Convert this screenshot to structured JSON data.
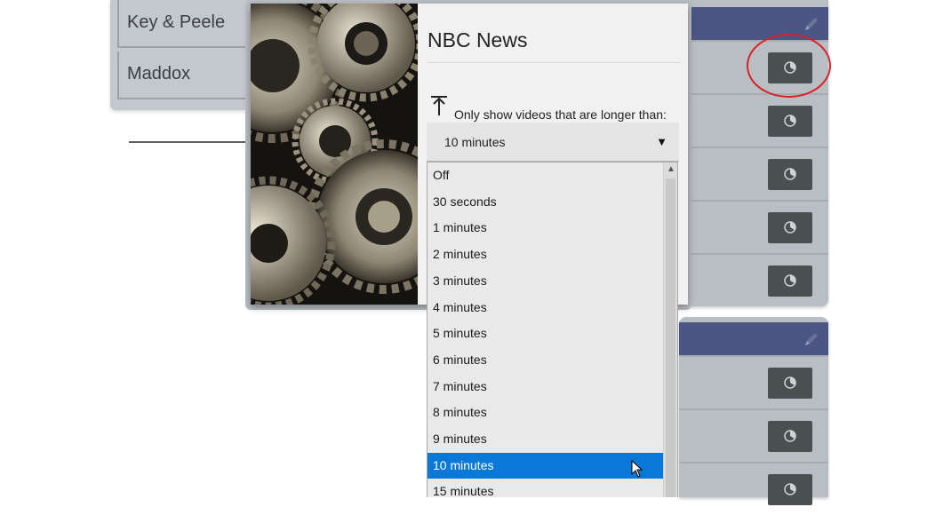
{
  "left_list": {
    "items": [
      "Key & Peele",
      "Maddox"
    ]
  },
  "popup": {
    "title": "NBC News",
    "filter_icon": "align-top-icon",
    "filter_label": "Only show videos that are longer than:",
    "selected_value": "10 minutes"
  },
  "dropdown": {
    "options": [
      "Off",
      "30 seconds",
      "1 minutes",
      "2 minutes",
      "3 minutes",
      "4 minutes",
      "5 minutes",
      "6 minutes",
      "7 minutes",
      "8 minutes",
      "9 minutes",
      "10 minutes",
      "15 minutes"
    ],
    "selected_index": 11
  },
  "colors": {
    "card_header": "#4b5685",
    "selected_option": "#0a78d7",
    "highlight_circle": "#d8222a"
  },
  "icons": {
    "card_edit": "pencil-icon",
    "row_button": "history-icon"
  }
}
